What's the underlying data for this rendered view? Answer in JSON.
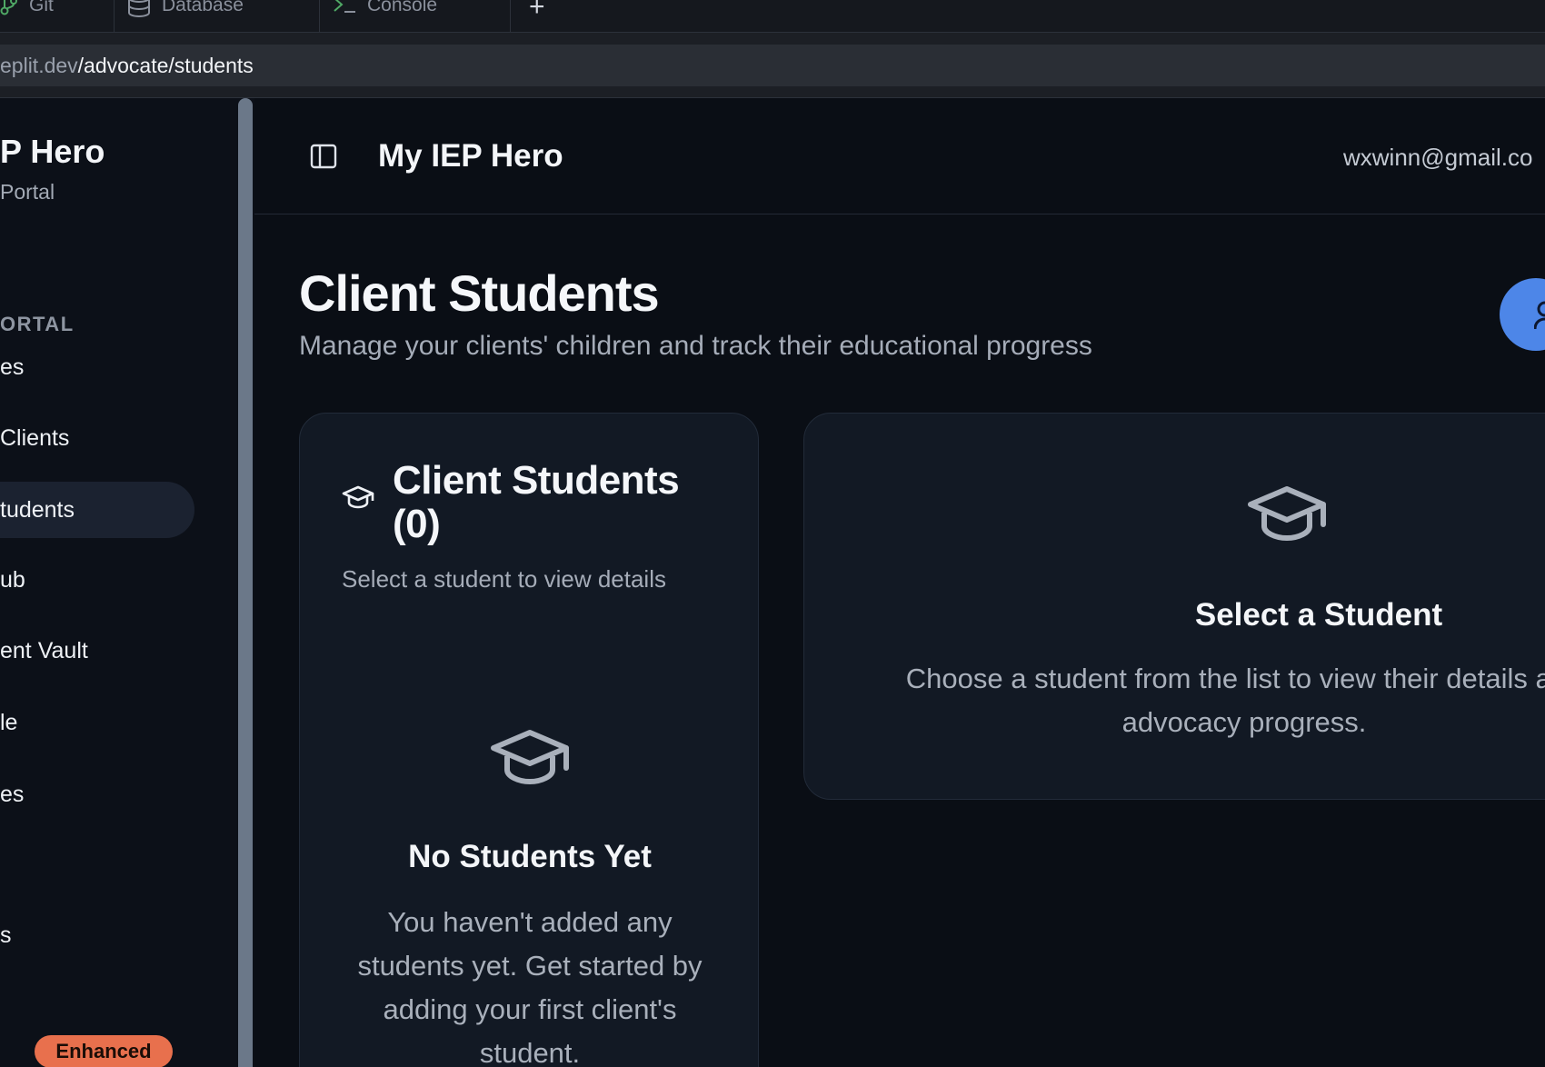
{
  "tabs": [
    {
      "label": "Git",
      "icon": "git-branch-icon"
    },
    {
      "label": "Database",
      "icon": "database-icon"
    },
    {
      "label": "Console",
      "icon": "terminal-icon"
    }
  ],
  "tab_add": "+",
  "url": {
    "host": "eplit.dev",
    "path": "/advocate/students"
  },
  "sidebar": {
    "brand": "P Hero",
    "brand_sub": " Portal",
    "section_label": "ORTAL",
    "items": [
      {
        "label": "es"
      },
      {
        "label": "Clients"
      },
      {
        "label": "tudents",
        "active": true
      },
      {
        "label": "ub"
      },
      {
        "label": "ent Vault"
      },
      {
        "label": "le"
      },
      {
        "label": "es"
      },
      {
        "label": "s"
      }
    ],
    "badge": "Enhanced"
  },
  "header": {
    "app_title": "My IEP Hero",
    "user_email": "wxwinn@gmail.co"
  },
  "page": {
    "title": "Client Students",
    "subtitle": "Manage your clients' children and track their educational progress"
  },
  "student_list": {
    "title": "Client Students (0)",
    "subtitle": "Select a student to view details",
    "empty_title": "No Students Yet",
    "empty_text": "You haven't added any students yet. Get started by adding your first client's student."
  },
  "detail_panel": {
    "title": "Select a Student",
    "text": "Choose a student from the list to view their details and advocacy progress."
  },
  "colors": {
    "background": "#0a0e15",
    "card": "#121924",
    "accent": "#4d86e8",
    "badge": "#e8704d"
  }
}
